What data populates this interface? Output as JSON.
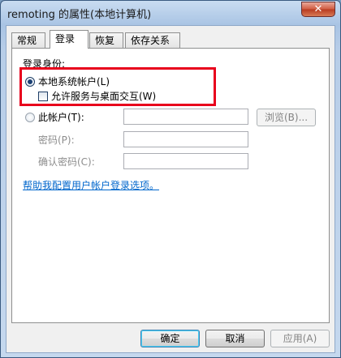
{
  "window": {
    "title": "remoting 的属性(本地计算机)"
  },
  "tabs": [
    {
      "label": "常规"
    },
    {
      "label": "登录"
    },
    {
      "label": "恢复"
    },
    {
      "label": "依存关系"
    }
  ],
  "logon": {
    "group_label": "登录身份:",
    "local_system_label": "本地系统帐户(L)",
    "allow_interact_label": "允许服务与桌面交互(W)",
    "this_account_label": "此帐户(T):",
    "account_value": "",
    "browse_label": "浏览(B)...",
    "password_label": "密码(P):",
    "password_value": "",
    "confirm_label": "确认密码(C):",
    "confirm_value": "",
    "help_link": "帮助我配置用户帐户登录选项。"
  },
  "buttons": {
    "ok": "确定",
    "cancel": "取消",
    "apply": "应用(A)"
  }
}
